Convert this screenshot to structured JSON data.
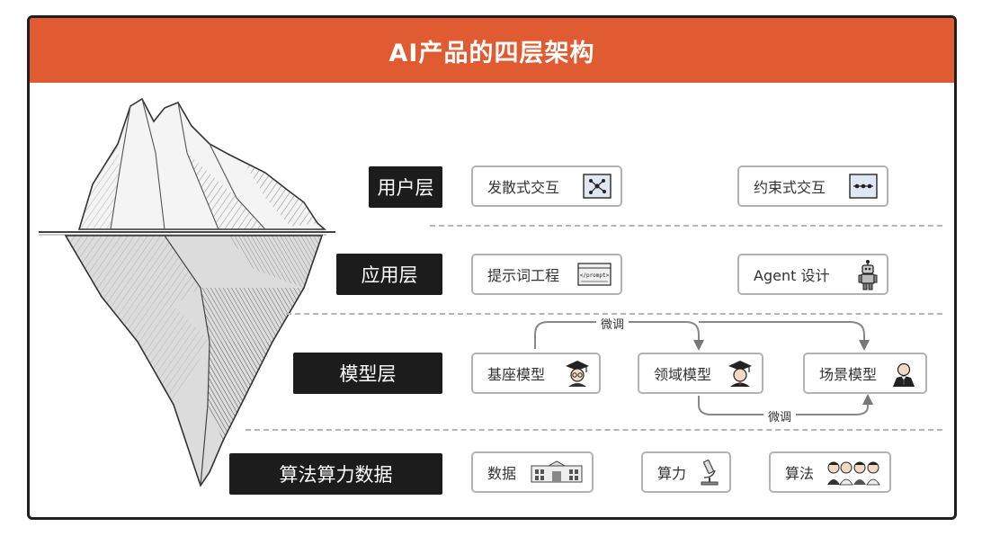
{
  "title": "AI产品的四层架构",
  "colors": {
    "header": "#e05a32",
    "label_bg": "#1c1c1c",
    "card_border": "#b3b3b3",
    "dash": "#b5b5b5"
  },
  "layers": [
    {
      "label": "用户层",
      "items": [
        "发散式交互",
        "约束式交互"
      ]
    },
    {
      "label": "应用层",
      "items": [
        "提示词工程",
        "Agent 设计"
      ]
    },
    {
      "label": "模型层",
      "items": [
        "基座模型",
        "领域模型",
        "场景模型"
      ]
    },
    {
      "label": "算法算力数据",
      "items": [
        "数据",
        "算力",
        "算法"
      ]
    }
  ],
  "fine_tune_labels": [
    "微调",
    "微调"
  ],
  "icons": {
    "divergent": "network-graph-icon",
    "constrained": "linear-flow-icon",
    "prompt": "prompt-window-icon",
    "agent": "robot-icon",
    "base_model": "graduate-cap-glasses-icon",
    "domain_model": "graduate-cap-icon",
    "scene_model": "businessman-icon",
    "data": "building-icon",
    "compute": "microscope-icon",
    "algorithm": "people-group-icon"
  },
  "prompt_icon_text": "</prompt>"
}
